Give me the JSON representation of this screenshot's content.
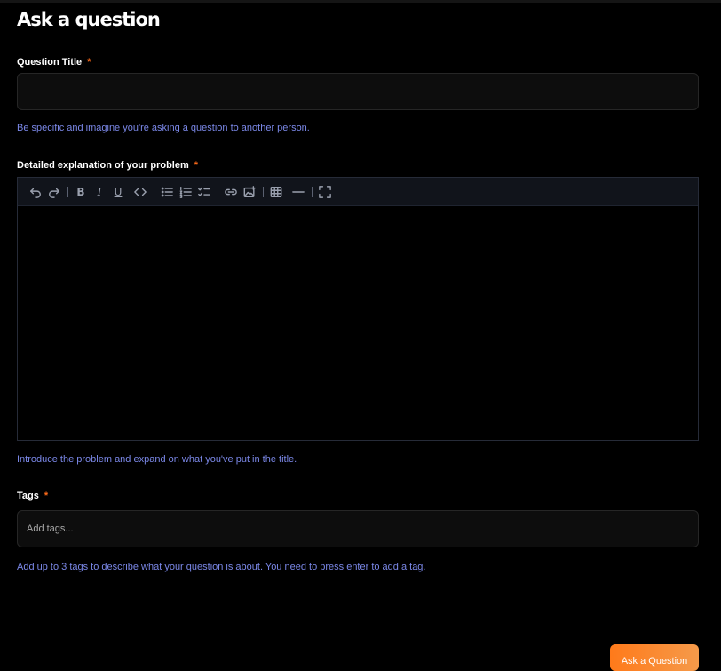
{
  "page": {
    "title": "Ask a question"
  },
  "title_field": {
    "label": "Question Title",
    "required_mark": "*",
    "value": "",
    "hint": "Be specific and imagine you're asking a question to another person."
  },
  "explanation_field": {
    "label": "Detailed explanation of your problem",
    "required_mark": "*",
    "toolbar": [
      "undo-icon",
      "redo-icon",
      "bold-icon",
      "italic-icon",
      "underline-icon",
      "code-icon",
      "bullet-list-icon",
      "numbered-list-icon",
      "checklist-icon",
      "link-icon",
      "image-icon",
      "table-icon",
      "horizontal-rule-icon",
      "fullscreen-icon"
    ],
    "toolbar_letters": {
      "bold": "B",
      "italic": "I",
      "underline": "U"
    },
    "hint": "Introduce the problem and expand on what you've put in the title."
  },
  "tags_field": {
    "label": "Tags",
    "required_mark": "*",
    "placeholder": "Add tags...",
    "hint": "Add up to 3 tags to describe what your question is about. You need to press enter to add a tag."
  },
  "submit": {
    "label": "Ask a Question"
  },
  "colors": {
    "accent": "#ff7a1a",
    "hint": "#7b88e8",
    "background": "#000000"
  }
}
